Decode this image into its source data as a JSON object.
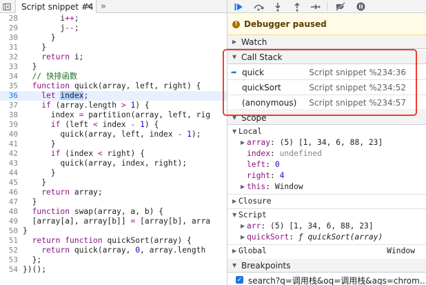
{
  "tab": {
    "label": "Script snippet #4"
  },
  "code_lines": [
    {
      "n": "28",
      "html": "<span class=\"op\">        i</span><span class=\"kw\">++</span><span class=\"op\">;</span>"
    },
    {
      "n": "29",
      "html": "<span class=\"op\">        j</span><span class=\"kw\">--</span><span class=\"op\">;</span>"
    },
    {
      "n": "30",
      "html": "<span class=\"op\">      }</span>"
    },
    {
      "n": "31",
      "html": "<span class=\"op\">    }</span>"
    },
    {
      "n": "32",
      "html": "<span class=\"kw2\">    return</span><span class=\"op\"> i;</span>"
    },
    {
      "n": "33",
      "html": "<span class=\"op\">  }</span>"
    },
    {
      "n": "34",
      "html": "<span class=\"cm\">  // 快排函数</span>"
    },
    {
      "n": "35",
      "html": "<span class=\"kw2\">  function</span><span class=\"op\"> quick(array, left, right) {</span>"
    },
    {
      "n": "36",
      "html": "<span class=\"kw2\">    let </span><span class=\"hl op\">index</span><span class=\"op\">;</span>",
      "current": true
    },
    {
      "n": "37",
      "html": "<span class=\"kw2\">    if</span><span class=\"op\"> (array.length </span><span class=\"kw\">&gt;</span><span class=\"num\"> 1</span><span class=\"op\">) {</span>"
    },
    {
      "n": "38",
      "html": "<span class=\"op\">      index </span><span class=\"kw\">=</span><span class=\"op\"> partition(array, left, rig</span>"
    },
    {
      "n": "39",
      "html": "<span class=\"kw2\">      if</span><span class=\"op\"> (left </span><span class=\"kw\">&lt;</span><span class=\"op\"> index </span><span class=\"kw\">-</span><span class=\"num\"> 1</span><span class=\"op\">) {</span>"
    },
    {
      "n": "40",
      "html": "<span class=\"op\">        quick(array, left, index </span><span class=\"kw\">-</span><span class=\"num\"> 1</span><span class=\"op\">);</span>"
    },
    {
      "n": "41",
      "html": "<span class=\"op\">      }</span>"
    },
    {
      "n": "42",
      "html": "<span class=\"kw2\">      if</span><span class=\"op\"> (index </span><span class=\"kw\">&lt;</span><span class=\"op\"> right) {</span>"
    },
    {
      "n": "43",
      "html": "<span class=\"op\">        quick(array, index, right);</span>"
    },
    {
      "n": "44",
      "html": "<span class=\"op\">      }</span>"
    },
    {
      "n": "45",
      "html": "<span class=\"op\">    }</span>"
    },
    {
      "n": "46",
      "html": "<span class=\"kw2\">    return</span><span class=\"op\"> array;</span>"
    },
    {
      "n": "47",
      "html": "<span class=\"op\">  }</span>"
    },
    {
      "n": "48",
      "html": "<span class=\"kw2\">  function</span><span class=\"op\"> swap(array, a, b) {</span>"
    },
    {
      "n": "49",
      "html": "<span class=\"op\">  [array[a], array[b]] </span><span class=\"kw\">=</span><span class=\"op\"> [array[b], arra</span>"
    },
    {
      "n": "50",
      "html": "<span class=\"op\">}</span>"
    },
    {
      "n": "51",
      "html": "<span class=\"kw2\">  return function</span><span class=\"op\"> quickSort(array) {</span>"
    },
    {
      "n": "52",
      "html": "<span class=\"kw2\">    return</span><span class=\"op\"> quick(array, </span><span class=\"num\">0</span><span class=\"op\">, array.length</span>"
    },
    {
      "n": "53",
      "html": "<span class=\"op\">  };</span>"
    },
    {
      "n": "54",
      "html": "<span class=\"op\">})();</span>"
    }
  ],
  "paused": {
    "label": "Debugger paused",
    "icon": "info-icon"
  },
  "sections": {
    "watch": "Watch",
    "call_stack": "Call Stack",
    "scope": "Scope",
    "breakpoints": "Breakpoints"
  },
  "call_stack": [
    {
      "fn": "quick",
      "loc": "Script snippet %234:36",
      "current": true
    },
    {
      "fn": "quickSort",
      "loc": "Script snippet %234:52",
      "current": false
    },
    {
      "fn": "(anonymous)",
      "loc": "Script snippet %234:57",
      "current": false
    }
  ],
  "scope": {
    "local_label": "Local",
    "local": {
      "array_key": "array",
      "array_val": "(5) [1, 34, 6, 88, 23]",
      "index_key": "index",
      "index_val": "undefined",
      "left_key": "left",
      "left_val": "0",
      "right_key": "right",
      "right_val": "4",
      "this_key": "this",
      "this_val": "Window"
    },
    "closure_label": "Closure",
    "script_label": "Script",
    "script": {
      "arr_key": "arr",
      "arr_val": "(5) [1, 34, 6, 88, 23]",
      "qs_key": "quickSort",
      "qs_val_prefix": "ƒ",
      "qs_val": "quickSort(array)"
    },
    "global_label": "Global",
    "global_val": "Window"
  },
  "breakpoint": {
    "label": "search?q=调用栈&oq=调用栈&aqs=chrom…",
    "checked": true
  },
  "colors": {
    "accent": "#1a73e8",
    "highlight_box": "#ee3b2b",
    "paused_bg": "#fffbe6"
  }
}
